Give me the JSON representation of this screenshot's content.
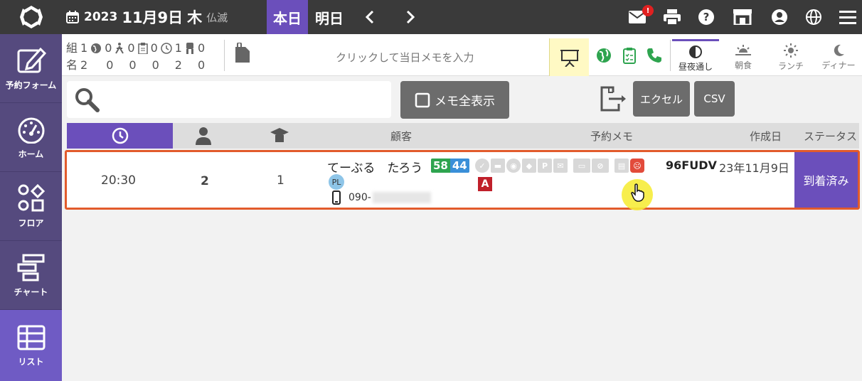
{
  "header": {
    "year": "2023",
    "month_day": "11月9日",
    "weekday": "木",
    "rokuyo": "仏滅",
    "tab_today": "本日",
    "tab_tomorrow": "明日",
    "mail_badge": "!"
  },
  "sidebar": {
    "items": [
      {
        "label": "予約フォーム",
        "icon": "edit-icon"
      },
      {
        "label": "ホーム",
        "icon": "gauge-icon"
      },
      {
        "label": "フロア",
        "icon": "floor-shapes-icon"
      },
      {
        "label": "チャート",
        "icon": "chart-icon"
      },
      {
        "label": "リスト",
        "icon": "list-icon"
      }
    ]
  },
  "summary": {
    "label_groups": "組",
    "label_people": "名",
    "groups": [
      "1",
      "0",
      "0",
      "0",
      "1",
      "0"
    ],
    "people": [
      "2",
      "0",
      "0",
      "0",
      "2",
      "0"
    ],
    "memo_placeholder": "クリックして当日メモを入力",
    "meals": [
      {
        "label": "昼夜通し",
        "icon": "half-moon-icon"
      },
      {
        "label": "朝食",
        "icon": "sunrise-icon"
      },
      {
        "label": "ランチ",
        "icon": "sun-icon"
      },
      {
        "label": "ディナー",
        "icon": "moon-icon"
      }
    ]
  },
  "toolbar": {
    "show_all_memo": "メモ全表示",
    "excel": "エクセル",
    "csv": "CSV"
  },
  "table": {
    "headers": {
      "customer": "顧客",
      "memo": "予約メモ",
      "created": "作成日",
      "status": "ステータス"
    },
    "rows": [
      {
        "time": "20:30",
        "people": "2",
        "groups": "1",
        "name": "てーぶる　たろう",
        "rank_a": "58",
        "rank_b": "44",
        "tag": "PL",
        "phone": "090-",
        "allergy": "A",
        "code": "96FUDV",
        "created": "23年11月9日",
        "status": "到着済み"
      }
    ]
  },
  "colors": {
    "accent": "#6b4fbb",
    "highlight_border": "#e25b2c",
    "green": "#2ea44f",
    "blue": "#3a8fd8"
  }
}
